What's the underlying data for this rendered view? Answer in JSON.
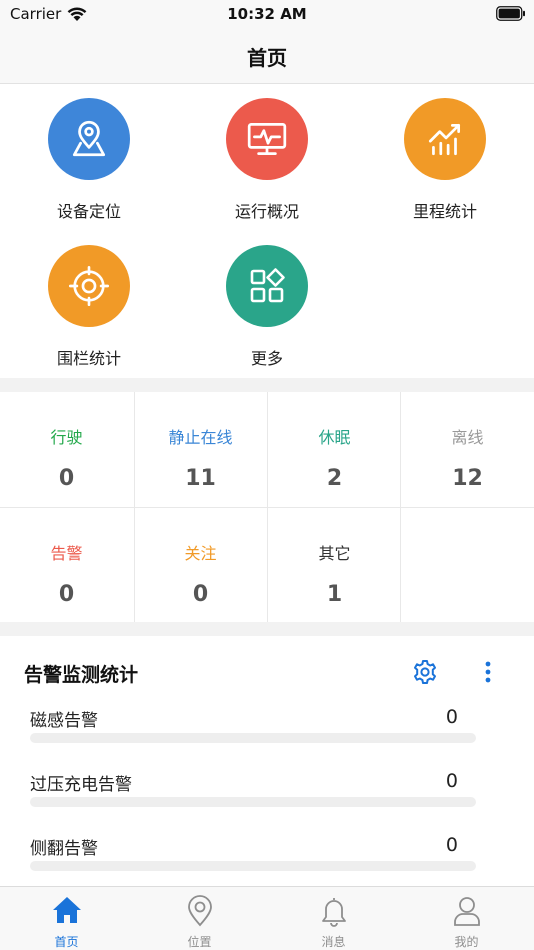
{
  "status_bar": {
    "carrier": "Carrier",
    "time": "10:32 AM"
  },
  "nav": {
    "title": "首页"
  },
  "menu": [
    {
      "label": "设备定位",
      "icon": "map-pin-icon",
      "color": "#3e86d9"
    },
    {
      "label": "运行概况",
      "icon": "monitor-pulse-icon",
      "color": "#ec5a4c"
    },
    {
      "label": "里程统计",
      "icon": "chart-trend-icon",
      "color": "#f19a27"
    },
    {
      "label": "围栏统计",
      "icon": "target-icon",
      "color": "#f19a27"
    },
    {
      "label": "更多",
      "icon": "apps-grid-icon",
      "color": "#2aa58a"
    }
  ],
  "stats": [
    {
      "label": "行驶",
      "value": "0",
      "color": "#22a84a"
    },
    {
      "label": "静止在线",
      "value": "11",
      "color": "#3a86d6"
    },
    {
      "label": "休眠",
      "value": "2",
      "color": "#2aa58a"
    },
    {
      "label": "离线",
      "value": "12",
      "color": "#999999"
    },
    {
      "label": "告警",
      "value": "0",
      "color": "#ec5a4c"
    },
    {
      "label": "关注",
      "value": "0",
      "color": "#f19a27"
    },
    {
      "label": "其它",
      "value": "1",
      "color": "#333333"
    }
  ],
  "alarm": {
    "title": "告警监测统计",
    "items": [
      {
        "name": "磁感告警",
        "count": "0",
        "progress": 0
      },
      {
        "name": "过压充电告警",
        "count": "0",
        "progress": 0
      },
      {
        "name": "侧翻告警",
        "count": "0",
        "progress": 0
      }
    ]
  },
  "tabs": [
    {
      "label": "首页",
      "icon": "home-icon",
      "active": true
    },
    {
      "label": "位置",
      "icon": "location-icon",
      "active": false
    },
    {
      "label": "消息",
      "icon": "bell-icon",
      "active": false
    },
    {
      "label": "我的",
      "icon": "user-icon",
      "active": false
    }
  ],
  "colors": {
    "accent": "#1a73d9",
    "inactive_tab": "#8e8e8e"
  }
}
